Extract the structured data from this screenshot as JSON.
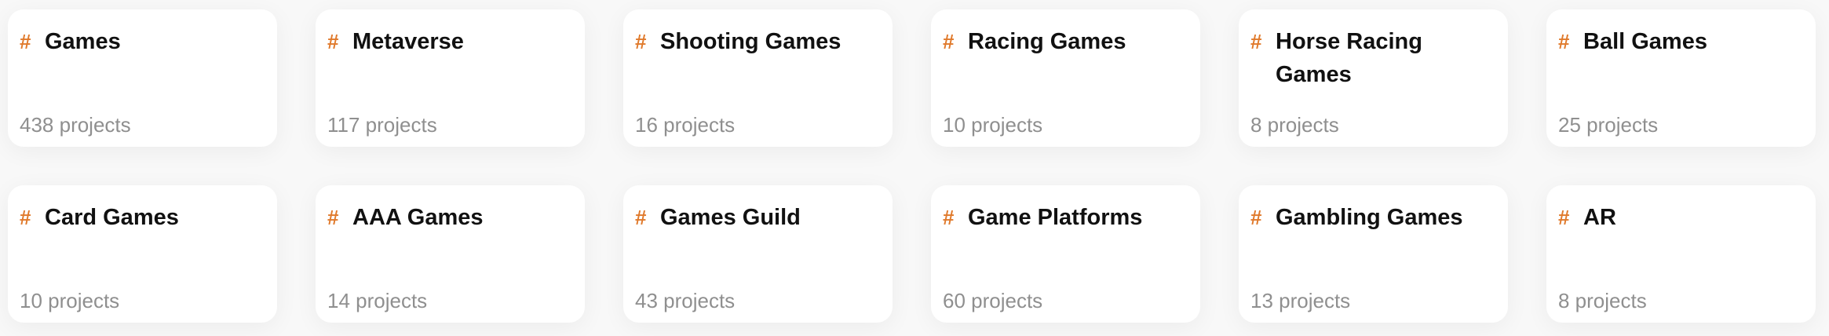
{
  "colors": {
    "accent": "#e07a2c",
    "title": "#111111",
    "count": "#8f8f8f",
    "card_bg": "#ffffff",
    "page_bg": "#f8f8f8"
  },
  "tag_symbol": "#",
  "categories": [
    {
      "title": "Games",
      "count": "438 projects"
    },
    {
      "title": "Metaverse",
      "count": "117 projects"
    },
    {
      "title": "Shooting Games",
      "count": "16 projects"
    },
    {
      "title": "Racing Games",
      "count": "10 projects"
    },
    {
      "title": "Horse Racing Games",
      "count": "8 projects"
    },
    {
      "title": "Ball Games",
      "count": "25 projects"
    },
    {
      "title": "Card Games",
      "count": "10 projects"
    },
    {
      "title": "AAA Games",
      "count": "14 projects"
    },
    {
      "title": "Games Guild",
      "count": "43 projects"
    },
    {
      "title": "Game Platforms",
      "count": "60 projects"
    },
    {
      "title": "Gambling Games",
      "count": "13 projects"
    },
    {
      "title": "AR",
      "count": "8 projects"
    }
  ]
}
